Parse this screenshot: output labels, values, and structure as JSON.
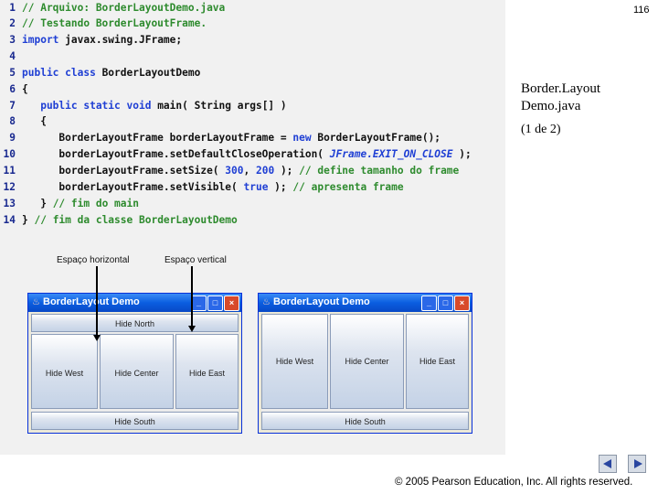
{
  "slide": {
    "page_number": "116",
    "title_line1": "Border.Layout",
    "title_line2": "Demo.java",
    "subtitle": "(1 de 2)",
    "copyright": "© 2005 Pearson Education, Inc.  All rights reserved."
  },
  "code": {
    "lines": [
      {
        "n": "1",
        "t": "// Arquivo: BorderLayoutDemo.java"
      },
      {
        "n": "2",
        "t": "// Testando BorderLayoutFrame."
      },
      {
        "n": "3",
        "a": "import",
        "b": " javax.swing.JFrame;"
      },
      {
        "n": "4"
      },
      {
        "n": "5",
        "a": "public class",
        "b": " BorderLayoutDemo"
      },
      {
        "n": "6",
        "t": "{"
      },
      {
        "n": "7",
        "a": "   public static void",
        "b": " main( String args[] )"
      },
      {
        "n": "8",
        "t": "   {"
      },
      {
        "n": "9",
        "a": "      BorderLayoutFrame borderLayoutFrame = ",
        "b": "new",
        "c": " BorderLayoutFrame();"
      },
      {
        "n": "10",
        "a": "      borderLayoutFrame.setDefaultCloseOperation( ",
        "b": "JFrame.EXIT_ON_CLOSE",
        "c": " );"
      },
      {
        "n": "11",
        "a": "      borderLayoutFrame.setSize( ",
        "b": "300",
        "c": ", ",
        "d": "200",
        "e": " ); ",
        "f": "// define tamanho do frame"
      },
      {
        "n": "12",
        "a": "      borderLayoutFrame.setVisible( ",
        "b": "true",
        "c": " ); ",
        "d": "// apresenta frame"
      },
      {
        "n": "13",
        "a": "   } ",
        "b": "// fim do main"
      },
      {
        "n": "14",
        "a": "} ",
        "b": "// fim da classe BorderLayoutDemo"
      }
    ]
  },
  "annotations": {
    "horizontal": "Espaço horizontal",
    "vertical": "Espaço vertical"
  },
  "windows": [
    {
      "title": "BorderLayout Demo",
      "buttons": {
        "north": "Hide North",
        "west": "Hide West",
        "center": "Hide Center",
        "east": "Hide East",
        "south": "Hide South"
      }
    },
    {
      "title": "BorderLayout Demo",
      "buttons": {
        "west": "Hide West",
        "center": "Hide Center",
        "east": "Hide East",
        "south": "Hide South"
      }
    }
  ],
  "nav": {
    "prev_icon": "triangle-left-icon",
    "next_icon": "triangle-right-icon"
  }
}
